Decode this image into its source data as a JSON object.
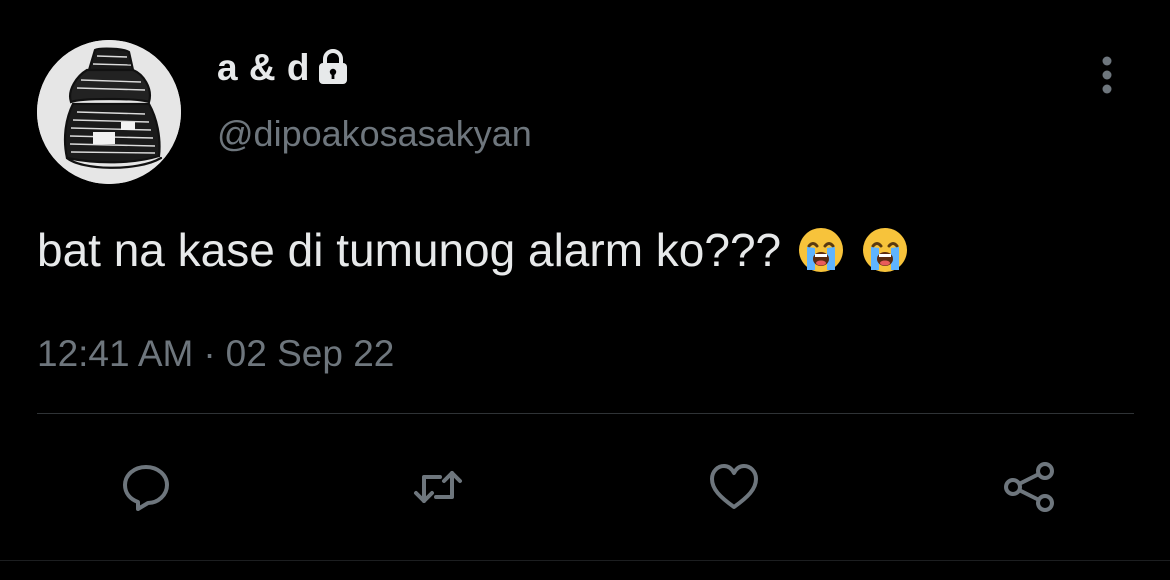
{
  "tweet": {
    "display_name": "a & d",
    "handle": "@dipoakosasakyan",
    "text": "bat na kase di tumunog alarm ko???",
    "emojis": [
      "loudly-crying-face-emoji",
      "loudly-crying-face-emoji"
    ],
    "time": "12:41 AM",
    "separator": "·",
    "date": "02 Sep 22",
    "protected": true
  },
  "icons": {
    "lock": "lock-icon",
    "more": "more-vertical-icon",
    "reply": "reply-icon",
    "retweet": "retweet-icon",
    "like": "heart-icon",
    "share": "share-icon"
  },
  "colors": {
    "background": "#000000",
    "primary_text": "#e7e9ea",
    "secondary_text": "#6e767d",
    "divider": "#2f3336"
  }
}
